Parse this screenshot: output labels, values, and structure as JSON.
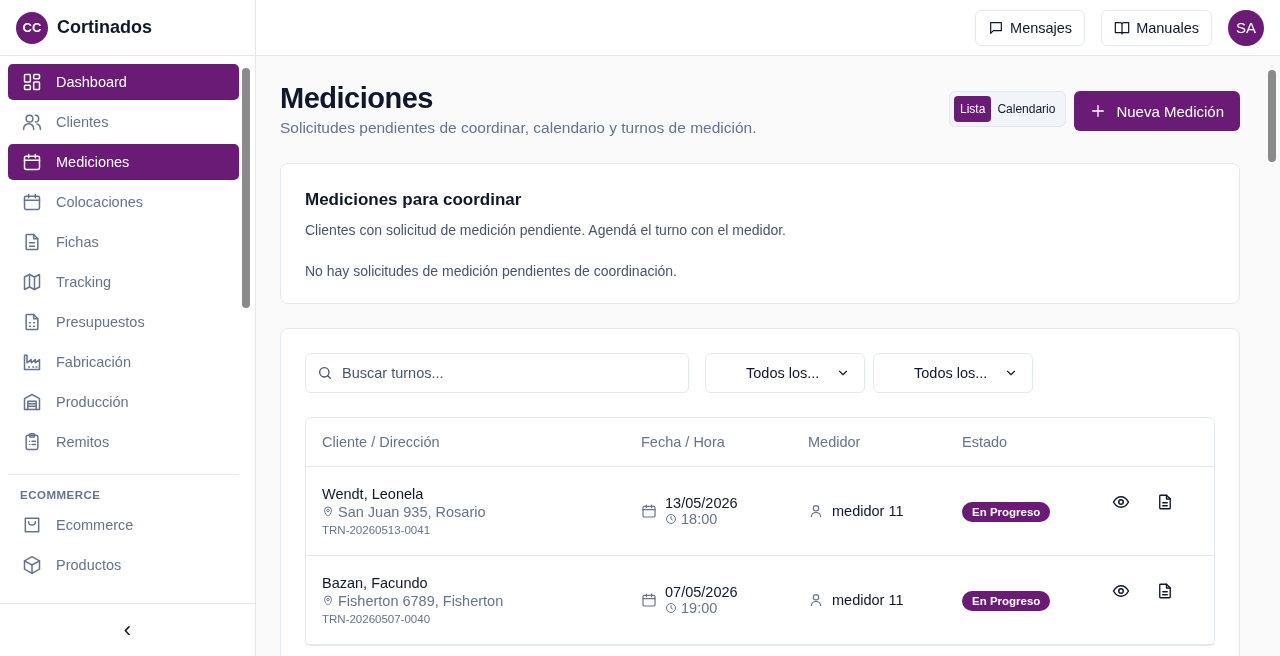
{
  "brand": {
    "initials": "CC",
    "name": "Cortinados"
  },
  "sidebar": {
    "items": [
      {
        "label": "Dashboard",
        "selected": true
      },
      {
        "label": "Clientes",
        "selected": false
      },
      {
        "label": "Mediciones",
        "selected": true
      },
      {
        "label": "Colocaciones",
        "selected": false
      },
      {
        "label": "Fichas",
        "selected": false
      },
      {
        "label": "Tracking",
        "selected": false
      },
      {
        "label": "Presupuestos",
        "selected": false
      },
      {
        "label": "Fabricación",
        "selected": false
      },
      {
        "label": "Producción",
        "selected": false
      },
      {
        "label": "Remitos",
        "selected": false
      }
    ],
    "section": "ECOMMERCE",
    "section_items": [
      {
        "label": "Ecommerce",
        "selected": false
      },
      {
        "label": "Productos",
        "selected": false
      }
    ],
    "collapse": "‹"
  },
  "topbar": {
    "buttons": [
      "Mensajes",
      "Manuales"
    ],
    "avatar": "SA"
  },
  "page": {
    "title": "Mediciones",
    "subtitle": "Solicitudes pendientes de coordinar, calendario y turnos de medición.",
    "view_tabs": [
      {
        "label": "Lista",
        "selected": true
      },
      {
        "label": "Calendario",
        "selected": false
      }
    ],
    "primary_button": "Nueva Medición"
  },
  "pending_card": {
    "title": "Mediciones para coordinar",
    "description": "Clientes con solicitud de medición pendiente. Agendá el turno con el medidor.",
    "empty": "No hay solicitudes de medición pendientes de coordinación."
  },
  "filters": {
    "search": {
      "placeholder": "Buscar turnos..."
    },
    "selects": [
      "Todos los...",
      "Todos los..."
    ]
  },
  "table": {
    "columns": [
      "Cliente / Dirección",
      "Fecha / Hora",
      "Medidor",
      "Estado"
    ],
    "rows": [
      {
        "client": "Wendt, Leonela",
        "address": "San Juan 935, Rosario",
        "code": "TRN-20260513-0041",
        "date": "13/05/2026",
        "time": "18:00",
        "measurer": "medidor 11",
        "status": "En Progreso"
      },
      {
        "client": "Bazan, Facundo",
        "address": "Fisherton 6789, Fisherton",
        "code": "TRN-20260507-0040",
        "date": "07/05/2026",
        "time": "19:00",
        "measurer": "medidor 11",
        "status": "En Progreso"
      }
    ]
  }
}
